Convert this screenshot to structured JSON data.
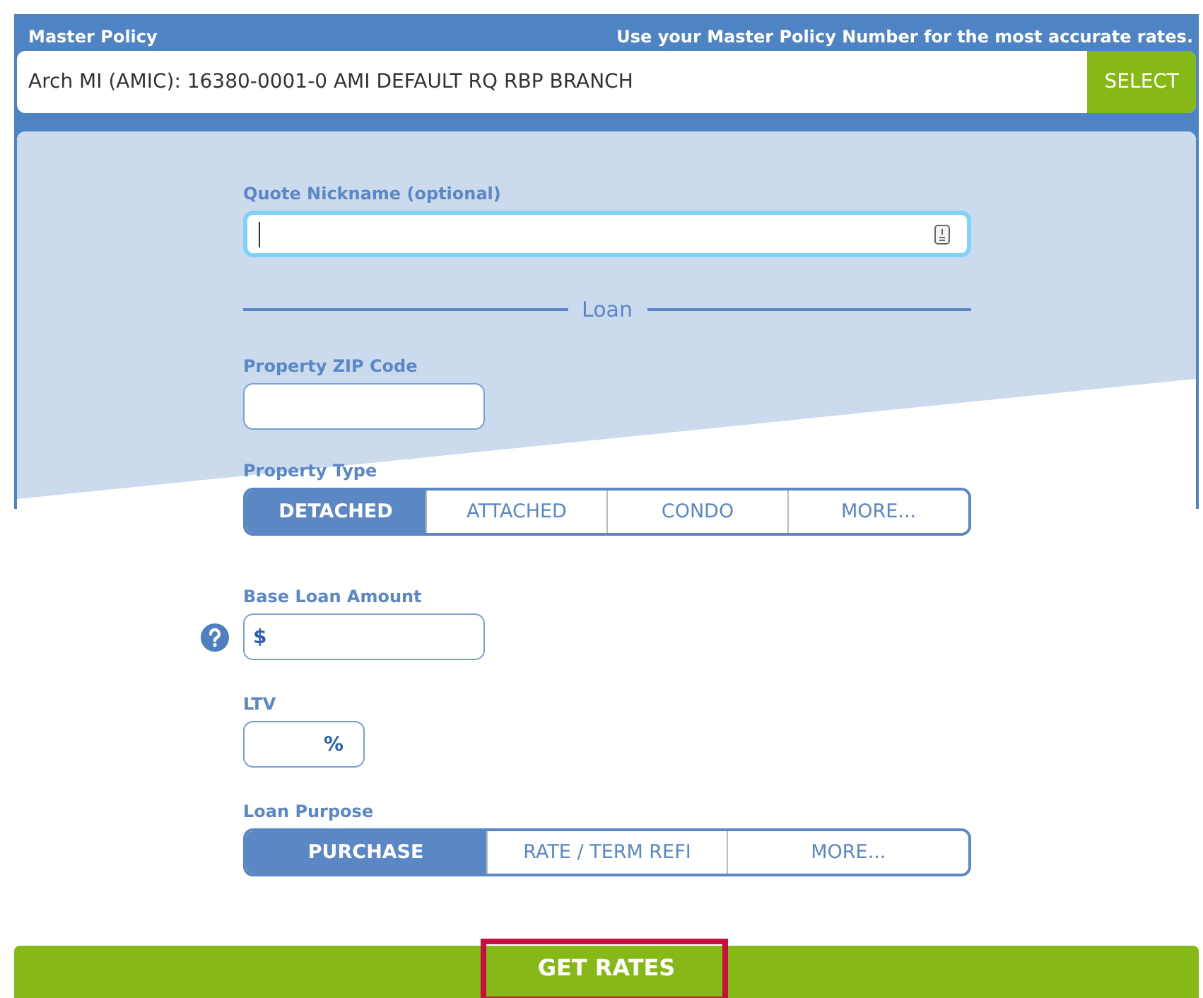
{
  "master_policy": {
    "label": "Master Policy",
    "hint": "Use your Master Policy Number for the most accurate rates.",
    "value": "Arch MI (AMIC): 16380-0001-0 AMI DEFAULT RQ RBP BRANCH",
    "button": "SELECT"
  },
  "form": {
    "nickname": {
      "label": "Quote Nickname (optional)",
      "focused": true
    },
    "section": "Loan",
    "zip": {
      "label": "Property ZIP Code"
    },
    "property_type": {
      "label": "Property Type",
      "options": [
        {
          "label": "DETACHED",
          "selected": true
        },
        {
          "label": "ATTACHED",
          "selected": false
        },
        {
          "label": "CONDO",
          "selected": false
        },
        {
          "label": "MORE...",
          "selected": false
        }
      ]
    },
    "base_loan": {
      "label": "Base Loan Amount",
      "prefix": "$"
    },
    "ltv": {
      "label": "LTV",
      "suffix": "%"
    },
    "loan_purpose": {
      "label": "Loan Purpose",
      "options": [
        {
          "label": "PURCHASE",
          "selected": true
        },
        {
          "label": "RATE / TERM REFI",
          "selected": false
        },
        {
          "label": "MORE...",
          "selected": false
        }
      ]
    }
  },
  "get_rates": {
    "label": "GET RATES",
    "highlighted": true
  }
}
